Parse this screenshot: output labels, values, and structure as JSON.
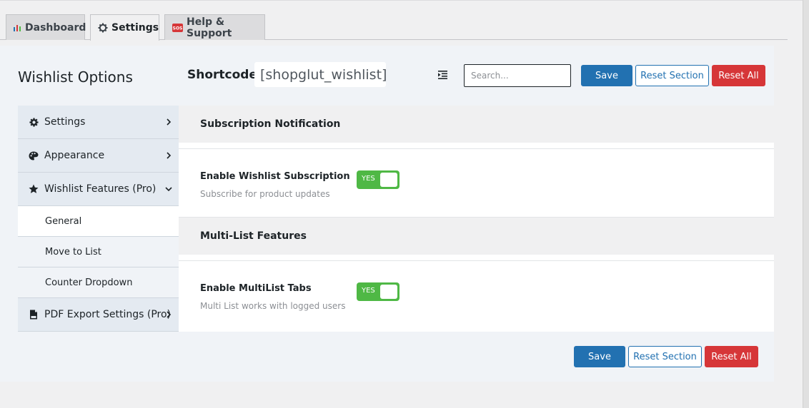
{
  "tabs": [
    {
      "label": "Dashboard",
      "icon": "bar-chart-icon"
    },
    {
      "label": "Settings",
      "icon": "gear-icon"
    },
    {
      "label": "Help & Support",
      "icon": "sos-icon"
    }
  ],
  "header": {
    "title": "Wishlist Options",
    "shortcode_label": "Shortcode:",
    "shortcode_value": "[shopglut_wishlist]",
    "search_placeholder": "Search...",
    "save_label": "Save",
    "reset_section_label": "Reset Section",
    "reset_all_label": "Reset All"
  },
  "sidebar": {
    "items": [
      {
        "label": "Settings",
        "icon": "gear-icon"
      },
      {
        "label": "Appearance",
        "icon": "palette-icon"
      },
      {
        "label": "Wishlist Features (Pro)",
        "icon": "star-icon"
      },
      {
        "label": "PDF Export Settings (Pro)",
        "icon": "pdf-icon"
      }
    ],
    "sub_items": [
      "General",
      "Move to List",
      "Counter Dropdown"
    ]
  },
  "content": {
    "sections": [
      {
        "title": "Subscription Notification",
        "field_title": "Enable Wishlist Subscription",
        "field_desc": "Subscribe for product updates",
        "toggle_label": "YES"
      },
      {
        "title": "Multi-List Features",
        "field_title": "Enable MultiList Tabs",
        "field_desc": "Multi List works with logged users",
        "toggle_label": "YES"
      }
    ]
  },
  "footer": {
    "save_label": "Save",
    "reset_section_label": "Reset Section",
    "reset_all_label": "Reset All"
  },
  "colors": {
    "primary": "#2271b1",
    "danger": "#d63638",
    "toggle_on": "#4fb845"
  }
}
